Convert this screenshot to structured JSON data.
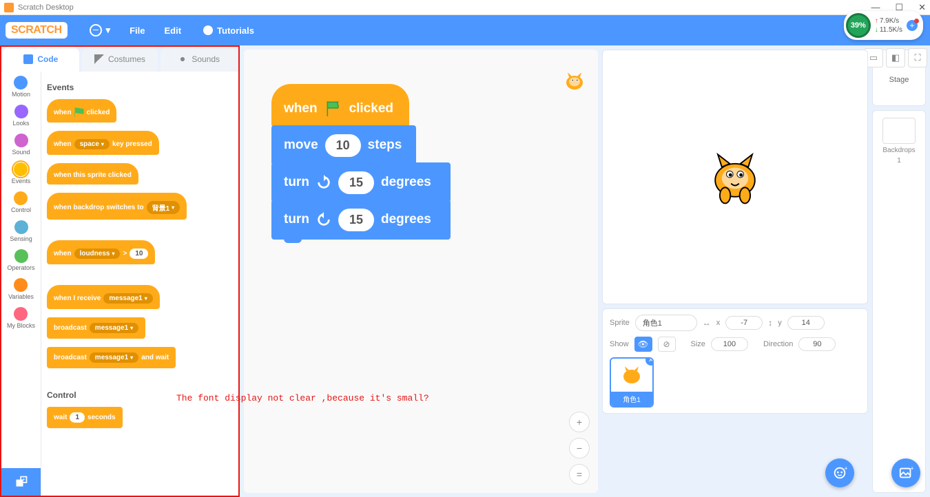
{
  "window": {
    "title": "Scratch Desktop"
  },
  "menubar": {
    "logo": "SCRATCH",
    "file": "File",
    "edit": "Edit",
    "tutorials": "Tutorials"
  },
  "netwidget": {
    "percent": "39%",
    "up": "7.9K/s",
    "down": "11.5K/s"
  },
  "tabs": {
    "code": "Code",
    "costumes": "Costumes",
    "sounds": "Sounds"
  },
  "categories": [
    {
      "name": "Motion",
      "color": "#4c97ff"
    },
    {
      "name": "Looks",
      "color": "#9966ff"
    },
    {
      "name": "Sound",
      "color": "#cf63cf"
    },
    {
      "name": "Events",
      "color": "#ffbf00"
    },
    {
      "name": "Control",
      "color": "#ffab19"
    },
    {
      "name": "Sensing",
      "color": "#5cb1d6"
    },
    {
      "name": "Operators",
      "color": "#59c059"
    },
    {
      "name": "Variables",
      "color": "#ff8c1a"
    },
    {
      "name": "My Blocks",
      "color": "#ff6680"
    }
  ],
  "palette": {
    "header_events": "Events",
    "header_control": "Control",
    "when_flag": {
      "pre": "when",
      "post": "clicked"
    },
    "when_key": {
      "pre": "when",
      "dd": "space",
      "post": "key pressed"
    },
    "when_sprite": "when this sprite clicked",
    "when_backdrop": {
      "pre": "when backdrop switches to",
      "dd": "背景1"
    },
    "when_loud": {
      "pre": "when",
      "dd": "loudness",
      "op": ">",
      "val": "10"
    },
    "when_receive": {
      "pre": "when I receive",
      "dd": "message1"
    },
    "broadcast": {
      "pre": "broadcast",
      "dd": "message1"
    },
    "broadcast_wait": {
      "pre": "broadcast",
      "dd": "message1",
      "post": "and wait"
    },
    "wait": {
      "pre": "wait",
      "val": "1",
      "post": "seconds"
    }
  },
  "script": {
    "hat": {
      "pre": "when",
      "post": "clicked"
    },
    "move": {
      "pre": "move",
      "val": "10",
      "post": "steps"
    },
    "turn_cw": {
      "pre": "turn",
      "val": "15",
      "post": "degrees"
    },
    "turn_ccw": {
      "pre": "turn",
      "val": "15",
      "post": "degrees"
    }
  },
  "annotation": "The font display not clear ,because it's small?",
  "sprite_info": {
    "label_sprite": "Sprite",
    "name": "角色1",
    "label_x": "x",
    "x": "-7",
    "label_y": "y",
    "y": "14",
    "label_show": "Show",
    "label_size": "Size",
    "size": "100",
    "label_direction": "Direction",
    "direction": "90"
  },
  "sprite_card": {
    "label": "角色1"
  },
  "stage_label": "Stage",
  "backdrops_label": "Backdrops",
  "backdrops_count": "1"
}
